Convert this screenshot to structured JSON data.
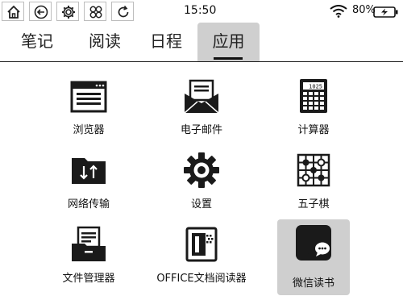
{
  "status": {
    "time": "15:50",
    "battery": "80%"
  },
  "tabs": [
    {
      "label": "笔记"
    },
    {
      "label": "阅读"
    },
    {
      "label": "日程"
    },
    {
      "label": "应用",
      "active": true
    }
  ],
  "apps": [
    {
      "label": "浏览器",
      "icon": "browser-icon"
    },
    {
      "label": "电子邮件",
      "icon": "mail-icon"
    },
    {
      "label": "计算器",
      "icon": "calculator-icon",
      "display": "1025"
    },
    {
      "label": "网络传输",
      "icon": "transfer-folder-icon"
    },
    {
      "label": "设置",
      "icon": "gear-icon"
    },
    {
      "label": "五子棋",
      "icon": "gomoku-board-icon"
    },
    {
      "label": "文件管理器",
      "icon": "file-manager-icon"
    },
    {
      "label": "OFFICE文档阅读器",
      "icon": "office-reader-icon"
    },
    {
      "label": "微信读书",
      "icon": "wechat-read-icon",
      "highlighted": true
    }
  ],
  "colors": {
    "highlight": "#cfcfcf",
    "icon": "#1a1a1a"
  }
}
